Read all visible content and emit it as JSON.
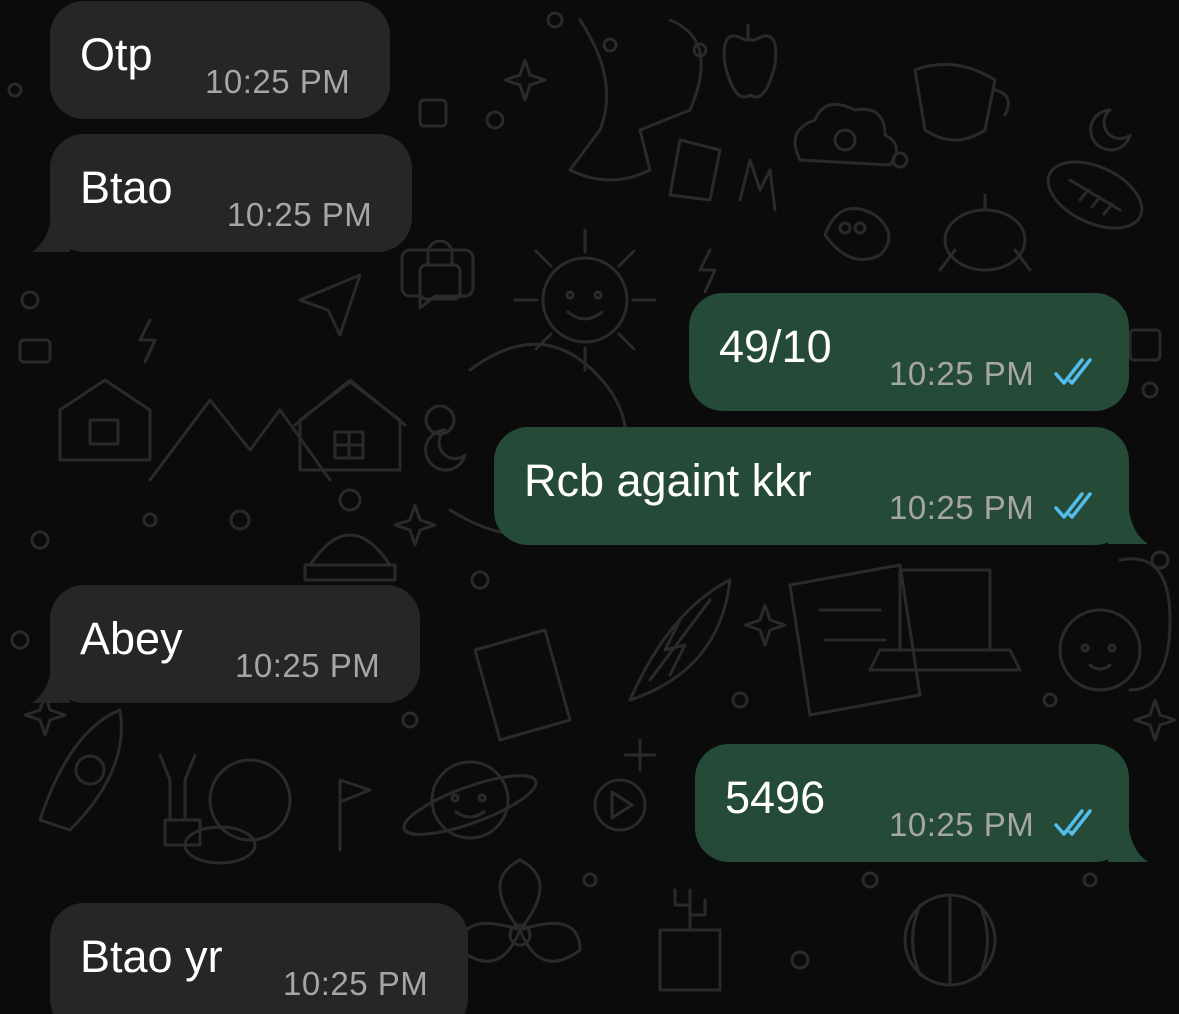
{
  "colors": {
    "background": "#0b0b0b",
    "incoming_bubble": "#262626",
    "outgoing_bubble": "#254a37",
    "text": "#ffffff",
    "timestamp": "#a6a6a6",
    "read_ticks": "#53bdeb"
  },
  "messages": [
    {
      "direction": "incoming",
      "text": "Otp",
      "time": "10:25 PM"
    },
    {
      "direction": "incoming",
      "text": "Btao",
      "time": "10:25 PM"
    },
    {
      "direction": "outgoing",
      "text": "49/10",
      "time": "10:25 PM",
      "status_icon": "double-check-read-icon"
    },
    {
      "direction": "outgoing",
      "text": "Rcb againt kkr",
      "time": "10:25 PM",
      "status_icon": "double-check-read-icon"
    },
    {
      "direction": "incoming",
      "text": "Abey",
      "time": "10:25 PM"
    },
    {
      "direction": "outgoing",
      "text": "5496",
      "time": "10:25 PM",
      "status_icon": "double-check-read-icon"
    },
    {
      "direction": "incoming",
      "text": "Btao yr",
      "time": "10:25 PM"
    }
  ]
}
